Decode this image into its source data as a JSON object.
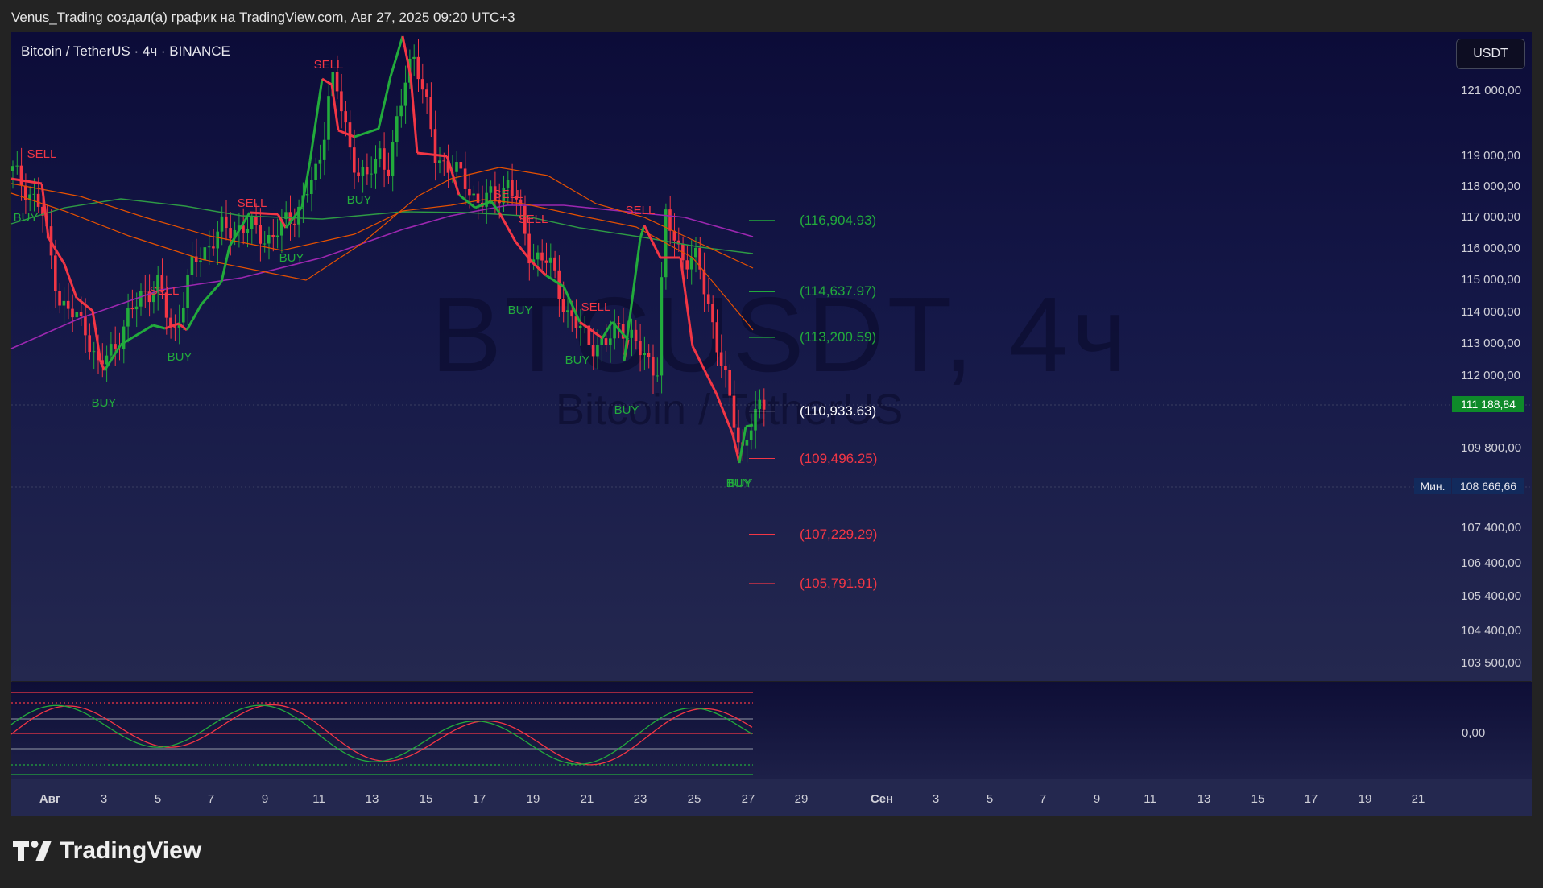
{
  "header": {
    "publish_text": "Venus_Trading создал(а) график на TradingView.com, Авг 27, 2025 09:20 UTC+3"
  },
  "chart": {
    "symbol_line": "Bitcoin / TetherUS · 4ч · BINANCE",
    "currency_button": "USDT",
    "watermark_title": "BTCUSDT, 4ч",
    "watermark_subtitle": "Bitcoin / TetherUS",
    "current_price": "111 188,84",
    "min_label": "Мин.",
    "min_price": "108 666,66",
    "price_axis": [
      {
        "label": "121 000,00",
        "value": 121000
      },
      {
        "label": "119 000,00",
        "value": 119000
      },
      {
        "label": "118 000,00",
        "value": 118000
      },
      {
        "label": "117 000,00",
        "value": 117000
      },
      {
        "label": "116 000,00",
        "value": 116000
      },
      {
        "label": "115 000,00",
        "value": 115000
      },
      {
        "label": "114 000,00",
        "value": 114000
      },
      {
        "label": "113 000,00",
        "value": 113000
      },
      {
        "label": "112 000,00",
        "value": 112000
      },
      {
        "label": "109 800,00",
        "value": 109800
      },
      {
        "label": "107 400,00",
        "value": 107400
      },
      {
        "label": "106 400,00",
        "value": 106400
      },
      {
        "label": "105 400,00",
        "value": 105400
      },
      {
        "label": "104 400,00",
        "value": 104400
      },
      {
        "label": "103 500,00",
        "value": 103500
      }
    ],
    "osc_axis_label": "0,00",
    "levels": [
      {
        "label": "(116,904.93)",
        "value": 116904.93,
        "color": "#22ab3c"
      },
      {
        "label": "(114,637.97)",
        "value": 114637.97,
        "color": "#22ab3c"
      },
      {
        "label": "(113,200.59)",
        "value": 113200.59,
        "color": "#22ab3c"
      },
      {
        "label": "(110,933.63)",
        "value": 110933.63,
        "color": "#ffffff"
      },
      {
        "label": "(109,496.25)",
        "value": 109496.25,
        "color": "#f23645"
      },
      {
        "label": "(107,229.29)",
        "value": 107229.29,
        "color": "#f23645"
      },
      {
        "label": "(105,791.91)",
        "value": 105791.91,
        "color": "#f23645"
      }
    ],
    "time_axis": [
      {
        "label": "Авг",
        "bold": true
      },
      {
        "label": "3"
      },
      {
        "label": "5"
      },
      {
        "label": "7"
      },
      {
        "label": "9"
      },
      {
        "label": "11"
      },
      {
        "label": "13"
      },
      {
        "label": "15"
      },
      {
        "label": "17"
      },
      {
        "label": "19"
      },
      {
        "label": "21"
      },
      {
        "label": "23"
      },
      {
        "label": "25"
      },
      {
        "label": "27"
      },
      {
        "label": "29"
      },
      {
        "label": "Сен",
        "bold": true
      },
      {
        "label": "3"
      },
      {
        "label": "5"
      },
      {
        "label": "7"
      },
      {
        "label": "9"
      },
      {
        "label": "11"
      },
      {
        "label": "13"
      },
      {
        "label": "15"
      },
      {
        "label": "17"
      },
      {
        "label": "19"
      },
      {
        "label": "21"
      }
    ],
    "signals": [
      {
        "label": "SELL",
        "type": "sell"
      },
      {
        "label": "BUY",
        "type": "buy"
      },
      {
        "label": "BUY",
        "type": "buy"
      },
      {
        "label": "SELL",
        "type": "sell"
      },
      {
        "label": "BUY",
        "type": "buy"
      },
      {
        "label": "SELL",
        "type": "sell"
      },
      {
        "label": "BUY",
        "type": "buy"
      },
      {
        "label": "SELL",
        "type": "sell"
      },
      {
        "label": "BUY",
        "type": "buy"
      },
      {
        "label": "SELL",
        "type": "sell"
      },
      {
        "label": "SELL",
        "type": "sell"
      },
      {
        "label": "BUY",
        "type": "buy"
      },
      {
        "label": "SELL",
        "type": "sell"
      },
      {
        "label": "BUY",
        "type": "buy"
      },
      {
        "label": "BUY",
        "type": "buy"
      },
      {
        "label": "SELL",
        "type": "sell"
      },
      {
        "label": "BUY",
        "type": "buy"
      },
      {
        "label": "BUY",
        "type": "buy"
      }
    ],
    "colors": {
      "bull": "#22ab3c",
      "bear": "#f23645",
      "ma_purple": "#9c27b0",
      "ma_green": "#2e9a45",
      "ma_orange": "#e65100"
    }
  },
  "brand": {
    "logo_text": "TradingView"
  }
}
